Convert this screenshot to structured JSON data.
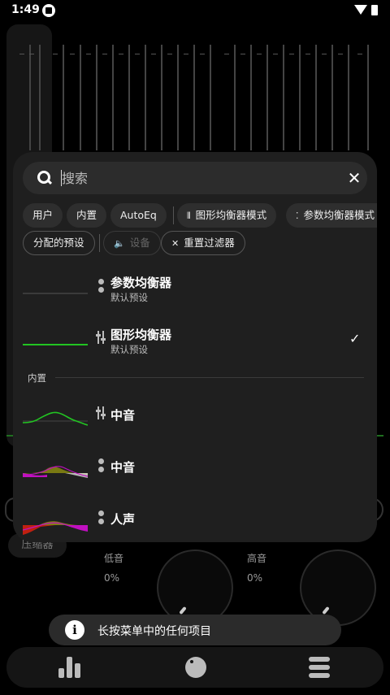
{
  "status_bar": {
    "time": "1:49"
  },
  "search": {
    "placeholder": "搜索",
    "value": ""
  },
  "filter_chips": {
    "user": "用户",
    "builtin": "内置",
    "autoeq": "AutoEq",
    "graphic_mode": "图形均衡器模式",
    "parametric_mode": "参数均衡器模式",
    "assigned_presets": "分配的预设",
    "device": "设备",
    "reset_filters": "重置过滤器"
  },
  "presets_top": [
    {
      "title": "参数均衡器",
      "subtitle": "默认预设",
      "type": "parametric"
    },
    {
      "title": "图形均衡器",
      "subtitle": "默认预设",
      "type": "graphic",
      "selected": true
    }
  ],
  "section_builtin": "内置",
  "presets_builtin": [
    {
      "title": "中音",
      "type": "graphic"
    },
    {
      "title": "中音",
      "type": "parametric"
    },
    {
      "title": "人声",
      "type": "parametric"
    }
  ],
  "background": {
    "bass_label": "低音",
    "bass_value": "0%",
    "treble_label": "高音",
    "treble_value": "0%",
    "compressor_label": "压缩器"
  },
  "snackbar": {
    "text": "长按菜单中的任何项目"
  },
  "colors": {
    "accent_green": "#22c422",
    "magenta": "#c010c0",
    "olive": "#8a8a10",
    "red": "#c02010"
  },
  "icons": {
    "search": "search-icon",
    "close": "close-icon",
    "check": "check-icon",
    "info": "info-icon",
    "speaker": "speaker-icon"
  }
}
